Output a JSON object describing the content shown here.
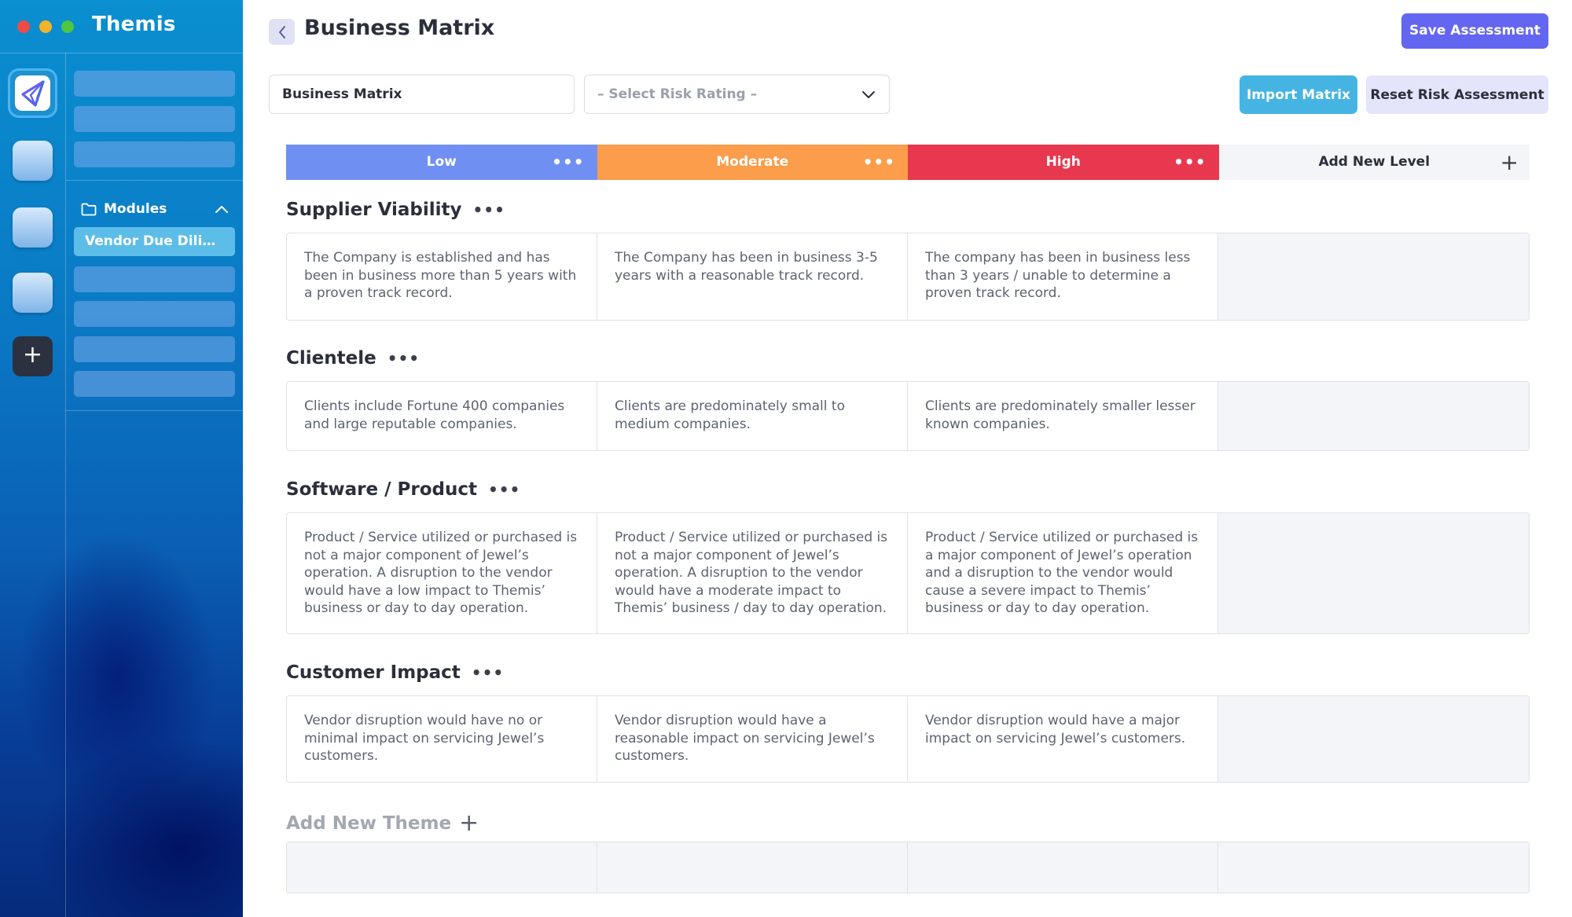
{
  "app": {
    "title": "Themis"
  },
  "sidebar": {
    "modules_label": "Modules",
    "active_module": "Vendor Due Dilige..."
  },
  "header": {
    "title": "Business Matrix",
    "save_label": "Save Assessment"
  },
  "toolbar": {
    "name_value": "Business Matrix",
    "risk_select_placeholder": "– Select Risk Rating –",
    "import_label": "Import Matrix",
    "reset_label": "Reset Risk Assessment"
  },
  "levels": [
    {
      "label": "Low",
      "color": "#6f8ff2"
    },
    {
      "label": "Moderate",
      "color": "#fb9d4b"
    },
    {
      "label": "High",
      "color": "#e8384f"
    }
  ],
  "add_level_label": "Add New Level",
  "themes": [
    {
      "name": "Supplier Viability",
      "cells": [
        "The Company is established and has been in business more than 5 years with a proven track record.",
        "The Company has been in business 3-5 years with a reasonable track record.",
        "The company has been in business less than 3 years / unable to determine a proven track record."
      ]
    },
    {
      "name": "Clientele",
      "cells": [
        "Clients include Fortune 400 companies and large reputable companies.",
        "Clients are predominately small to medium companies.",
        "Clients are predominately smaller lesser known companies."
      ]
    },
    {
      "name": "Software / Product",
      "cells": [
        "Product / Service utilized or purchased is not a major component of Jewel’s operation. A disruption to the vendor would have a low impact to Themis’ business or day to day operation.",
        "Product / Service utilized or purchased is not a major component of Jewel’s operation. A disruption to the vendor would have a moderate impact to Themis’ business / day to day operation.",
        "Product / Service utilized or purchased is a major component of Jewel’s operation and a disruption to the vendor would cause a severe impact to Themis’ business or day to day operation."
      ]
    },
    {
      "name": "Customer Impact",
      "cells": [
        "Vendor disruption would have no or minimal impact on servicing Jewel’s customers.",
        "Vendor disruption would have a reasonable impact on servicing Jewel’s customers.",
        "Vendor disruption would have a major impact on servicing Jewel’s customers."
      ]
    }
  ],
  "add_theme_label": "Add New Theme"
}
